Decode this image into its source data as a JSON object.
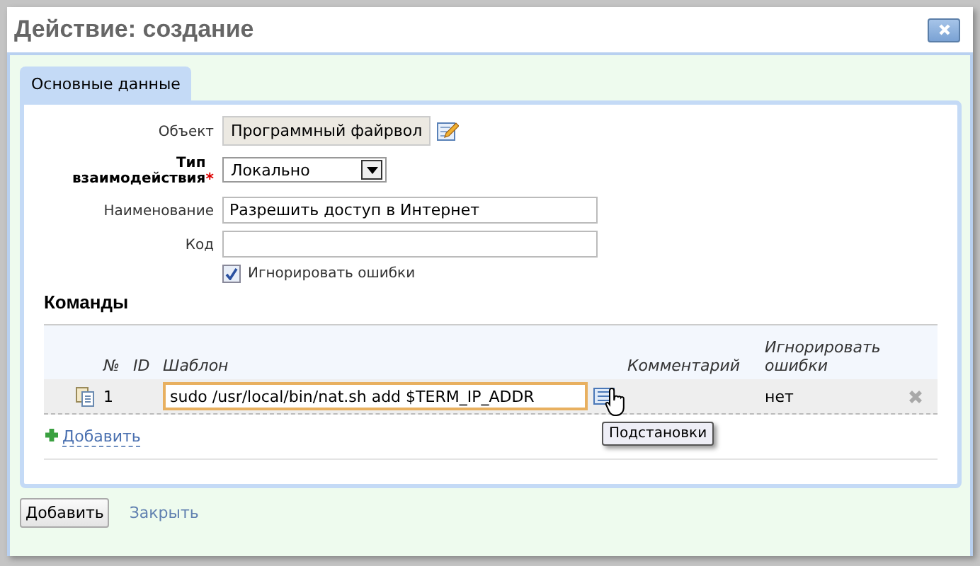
{
  "window": {
    "title": "Действие: создание"
  },
  "tabs": [
    {
      "label": "Основные данные",
      "selected": true
    }
  ],
  "form": {
    "object": {
      "label": "Объект",
      "value": "Программный файрвол"
    },
    "type": {
      "label": "Тип взаимодействия",
      "required_mark": "*",
      "value": "Локально"
    },
    "name": {
      "label": "Наименование",
      "value": "Разрешить доступ в Интернет"
    },
    "code": {
      "label": "Код"
    },
    "ignore_errors": {
      "label": "Игнорировать ошибки",
      "checked": true
    }
  },
  "commands": {
    "title": "Команды",
    "columns": [
      "№",
      "ID",
      "Шаблон",
      "Комментарий",
      "Игнорировать ошибки"
    ],
    "rows": [
      {
        "number": "1",
        "template": "sudo /usr/local/bin/nat.sh add $TERM_IP_ADDR",
        "ignore": "нет"
      }
    ],
    "add_link": "Добавить",
    "tooltip": "Подстановки"
  },
  "buttons": {
    "primary": "Добавить",
    "close": "Закрыть"
  }
}
